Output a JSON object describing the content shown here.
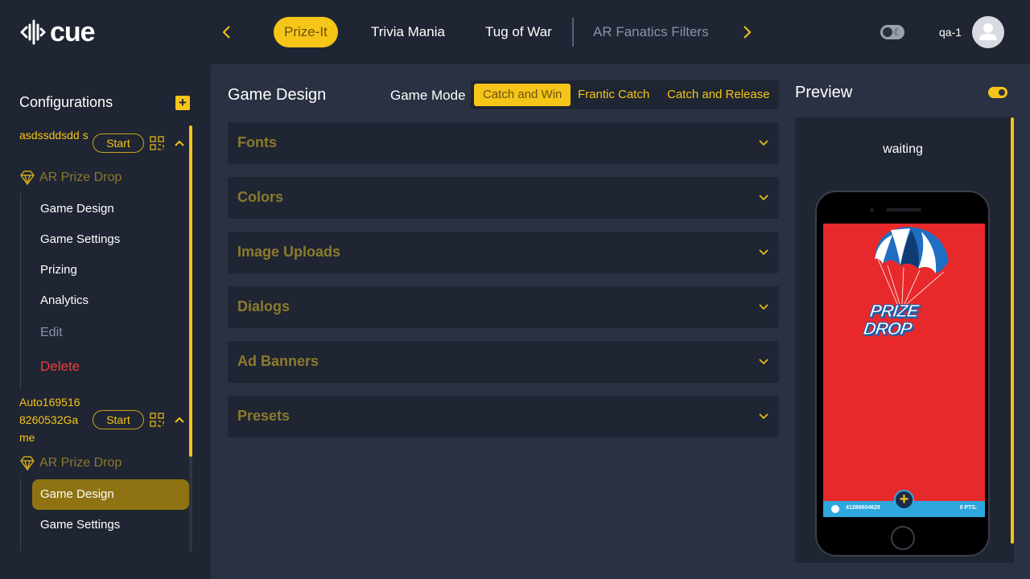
{
  "app": {
    "logo_text": "cue"
  },
  "nav": {
    "tabs": [
      {
        "label": "Prize-It",
        "active": true
      },
      {
        "label": "Trivia Mania"
      },
      {
        "label": "Tug of War"
      },
      {
        "label": "AR Fanatics Filters",
        "muted": true
      }
    ]
  },
  "user": {
    "name": "qa-1"
  },
  "sidebar": {
    "title": "Configurations",
    "configs": [
      {
        "name": "asdssddsdd s",
        "start_label": "Start",
        "game_type": "AR Prize Drop",
        "menu": [
          "Game Design",
          "Game Settings",
          "Prizing",
          "Analytics",
          "Edit",
          "Delete"
        ]
      },
      {
        "name": "Auto169516 8260532Ga me",
        "start_label": "Start",
        "game_type": "AR Prize Drop",
        "menu": [
          "Game Design",
          "Game Settings"
        ],
        "active_item": "Game Design"
      }
    ]
  },
  "main": {
    "title": "Game Design",
    "mode_label": "Game Mode",
    "modes": [
      "Catch and Win",
      "Frantic Catch",
      "Catch and Release"
    ],
    "active_mode": "Catch and Win",
    "sections": [
      "Fonts",
      "Colors",
      "Image Uploads",
      "Dialogs",
      "Ad Banners",
      "Presets"
    ]
  },
  "preview": {
    "title": "Preview",
    "status": "waiting",
    "game_logo": [
      "PRIZE",
      "DROP"
    ],
    "bar_id": "41286604629",
    "bar_points": "0 PTS."
  },
  "colors": {
    "accent": "#f5c518",
    "bg": "#1f2532",
    "panel": "#2a3142",
    "danger": "#ef3d3d",
    "screen": "#e8292b"
  }
}
